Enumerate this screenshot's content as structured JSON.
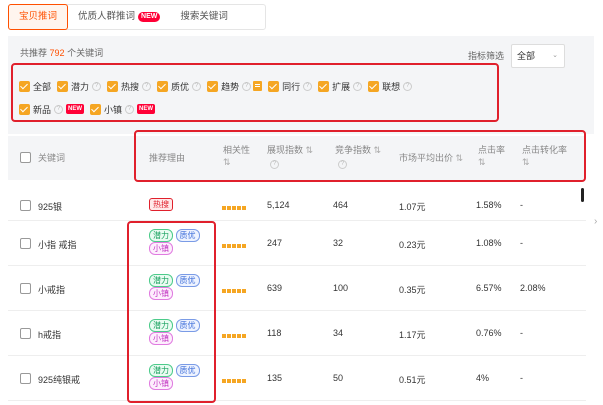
{
  "tabs": [
    {
      "label": "宝贝推词"
    },
    {
      "label": "优质人群推词",
      "badge": "NEW"
    },
    {
      "label": "搜索关键词"
    }
  ],
  "summary": {
    "prefix": "共推荐",
    "count": "792",
    "suffix": "个关键词"
  },
  "filter": {
    "label": "指标筛选",
    "value": "全部"
  },
  "checkboxes": [
    {
      "label": "全部",
      "checked": true
    },
    {
      "label": "潜力",
      "checked": true
    },
    {
      "label": "热搜",
      "checked": true
    },
    {
      "label": "质优",
      "checked": true
    },
    {
      "label": "趋势",
      "checked": true
    },
    {
      "label": "同行",
      "checked": true
    },
    {
      "label": "扩展",
      "checked": true
    },
    {
      "label": "联想",
      "checked": true
    },
    {
      "label": "新品",
      "checked": true,
      "badge": "NEW"
    },
    {
      "label": "小镇",
      "checked": true,
      "badge": "NEW"
    }
  ],
  "columns": {
    "keyword": "关键词",
    "reason": "推荐理由",
    "relevance": "相关性",
    "impressions": "展现指数",
    "competition": "竞争指数",
    "avg_bid": "市场平均出价",
    "ctr": "点击率",
    "cvr": "点击转化率"
  },
  "rows": [
    {
      "keyword": "925银",
      "tags": [
        "热搜"
      ],
      "impressions": "5,124",
      "competition": "464",
      "avg_bid": "1.07元",
      "ctr": "1.58%",
      "cvr": "-"
    },
    {
      "keyword": "小指 戒指",
      "tags": [
        "潜力",
        "质优",
        "小镇"
      ],
      "impressions": "247",
      "competition": "32",
      "avg_bid": "0.23元",
      "ctr": "1.08%",
      "cvr": "-"
    },
    {
      "keyword": "小戒指",
      "tags": [
        "潜力",
        "质优",
        "小镇"
      ],
      "impressions": "639",
      "competition": "100",
      "avg_bid": "0.35元",
      "ctr": "6.57%",
      "cvr": "2.08%"
    },
    {
      "keyword": "h戒指",
      "tags": [
        "潜力",
        "质优",
        "小镇"
      ],
      "impressions": "118",
      "competition": "34",
      "avg_bid": "1.17元",
      "ctr": "0.76%",
      "cvr": "-"
    },
    {
      "keyword": "925纯银戒",
      "tags": [
        "潜力",
        "质优",
        "小镇"
      ],
      "impressions": "135",
      "competition": "50",
      "avg_bid": "0.51元",
      "ctr": "4%",
      "cvr": "-"
    }
  ],
  "colors": {
    "accent": "#ff5000",
    "checkbox": "#f5a623",
    "highlight": "#e0202c"
  }
}
